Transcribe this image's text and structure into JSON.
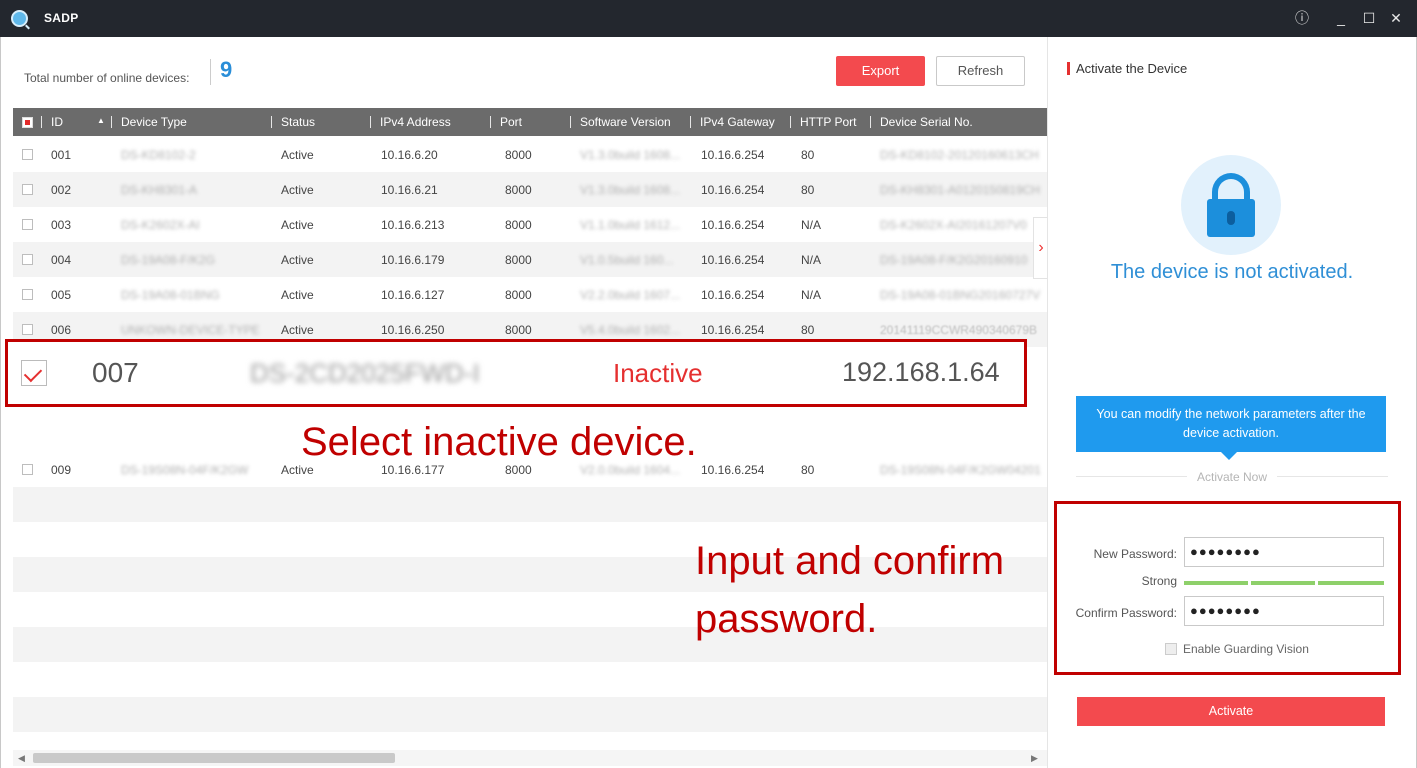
{
  "window": {
    "title": "SADP",
    "controls": {
      "info": "ⓘ",
      "minimize": "_",
      "maximize": "☐",
      "close": "✕"
    }
  },
  "toolbar": {
    "total_label": "Total number of online devices:",
    "total_count": "9",
    "export_label": "Export",
    "refresh_label": "Refresh"
  },
  "table": {
    "columns": [
      "ID",
      "Device Type",
      "Status",
      "IPv4 Address",
      "Port",
      "Software Version",
      "IPv4 Gateway",
      "HTTP Port",
      "Device Serial No."
    ],
    "rows": [
      {
        "id": "001",
        "type": "DS-KD8102-2",
        "status": "Active",
        "ip": "10.16.6.20",
        "port": "8000",
        "sw": "V1.3.0build 1608...",
        "gw": "10.16.6.254",
        "http": "80",
        "serial": "DS-KD8102-20120160613CH"
      },
      {
        "id": "002",
        "type": "DS-KH8301-A",
        "status": "Active",
        "ip": "10.16.6.21",
        "port": "8000",
        "sw": "V1.3.0build 1608...",
        "gw": "10.16.6.254",
        "http": "80",
        "serial": "DS-KH8301-A0120150819CH"
      },
      {
        "id": "003",
        "type": "DS-K2602X-AI",
        "status": "Active",
        "ip": "10.16.6.213",
        "port": "8000",
        "sw": "V1.1.0build 1612...",
        "gw": "10.16.6.254",
        "http": "N/A",
        "serial": "DS-K2602X-AI20161207V0"
      },
      {
        "id": "004",
        "type": "DS-19A08-F/K2G",
        "status": "Active",
        "ip": "10.16.6.179",
        "port": "8000",
        "sw": "V1.0.5build 160...",
        "gw": "10.16.6.254",
        "http": "N/A",
        "serial": "DS-19A08-F/K2G20160910"
      },
      {
        "id": "005",
        "type": "DS-19A08-01BNG",
        "status": "Active",
        "ip": "10.16.6.127",
        "port": "8000",
        "sw": "V2.2.0build 1607...",
        "gw": "10.16.6.254",
        "http": "N/A",
        "serial": "DS-19A08-01BNG20160727V"
      },
      {
        "id": "006",
        "type": "UNKOWN-DEVICE-TYPE",
        "status": "Active",
        "ip": "10.16.6.250",
        "port": "8000",
        "sw": "V5.4.0build 1602...",
        "gw": "10.16.6.254",
        "http": "80",
        "serial": "20141119CCWR490340679B"
      },
      {
        "id": "009",
        "type": "DS-19S08N-04F/K2GW",
        "status": "Active",
        "ip": "10.16.6.177",
        "port": "8000",
        "sw": "V2.0.0build 1604...",
        "gw": "10.16.6.254",
        "http": "80",
        "serial": "DS-19S08N-04F/K2GW04201"
      }
    ],
    "selected_row": {
      "id": "007",
      "type": "DS-2CD2025FWD-I",
      "status": "Inactive",
      "ip": "192.168.1.64"
    }
  },
  "annotations": {
    "select": "Select inactive device.",
    "input": "Input and confirm password."
  },
  "activate_panel": {
    "title": "Activate the Device",
    "status_text": "The device is not activated.",
    "tip": "You can modify the network parameters after the device activation.",
    "activate_now": "Activate Now",
    "new_password_label": "New Password:",
    "new_password_value": "●●●●●●●●",
    "strength_label": "Strong",
    "strength_level": "3/3",
    "confirm_password_label": "Confirm Password:",
    "confirm_password_value": "●●●●●●●●",
    "guarding_label": "Enable Guarding Vision",
    "activate_button": "Activate"
  },
  "colors": {
    "accent_red": "#f34a4e",
    "accent_blue": "#2f8fd6",
    "annotation_red": "#c00000",
    "strength_green": "#8ed06a"
  }
}
